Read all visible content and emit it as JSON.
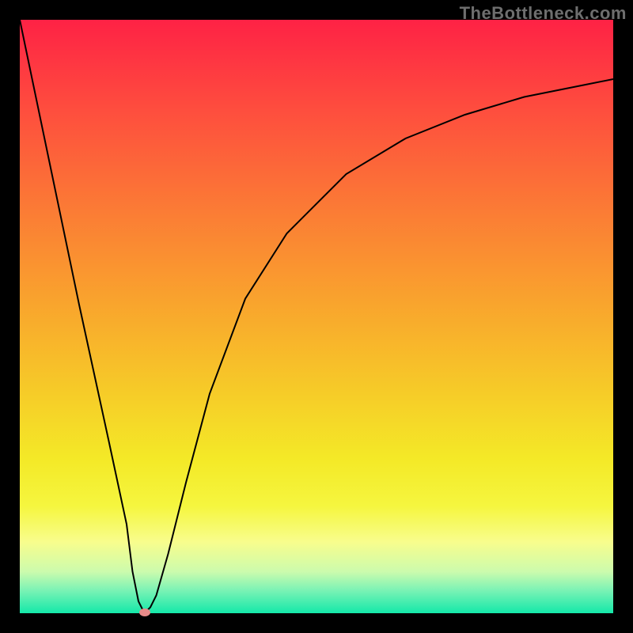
{
  "credit_text": "TheBottleneck.com",
  "colors": {
    "frame": "#000000",
    "curve": "#000000",
    "marker": "#e78b89"
  },
  "chart_data": {
    "type": "line",
    "title": "",
    "xlabel": "",
    "ylabel": "",
    "xlim": [
      0,
      100
    ],
    "ylim": [
      0,
      100
    ],
    "grid": false,
    "legend": false,
    "description": "Single black curve on rainbow-gradient background. Curve starts near top-left, drops almost linearly to a minimum near x≈21 (y≈0, touching bottom), then rises with diminishing slope toward top-right, asymptotically approaching y≈90.",
    "series": [
      {
        "name": "curve",
        "x": [
          0,
          5,
          10,
          15,
          18,
          19,
          20,
          21,
          22,
          23,
          25,
          28,
          32,
          38,
          45,
          55,
          65,
          75,
          85,
          95,
          100
        ],
        "y": [
          100,
          76,
          52,
          29,
          15,
          7,
          2,
          0,
          1,
          3,
          10,
          22,
          37,
          53,
          64,
          74,
          80,
          84,
          87,
          89,
          90
        ]
      }
    ],
    "marker": {
      "x": 21,
      "y": 0
    },
    "background_gradient_stops": [
      {
        "pos": 0.0,
        "color": "#fe2245"
      },
      {
        "pos": 0.15,
        "color": "#fe4d3e"
      },
      {
        "pos": 0.32,
        "color": "#fb7b35"
      },
      {
        "pos": 0.48,
        "color": "#f9a52d"
      },
      {
        "pos": 0.63,
        "color": "#f6cc28"
      },
      {
        "pos": 0.74,
        "color": "#f4e927"
      },
      {
        "pos": 0.82,
        "color": "#f5f63f"
      },
      {
        "pos": 0.88,
        "color": "#f8fd8d"
      },
      {
        "pos": 0.93,
        "color": "#ccfbad"
      },
      {
        "pos": 0.96,
        "color": "#7ef3b5"
      },
      {
        "pos": 1.0,
        "color": "#14e8a9"
      }
    ]
  }
}
